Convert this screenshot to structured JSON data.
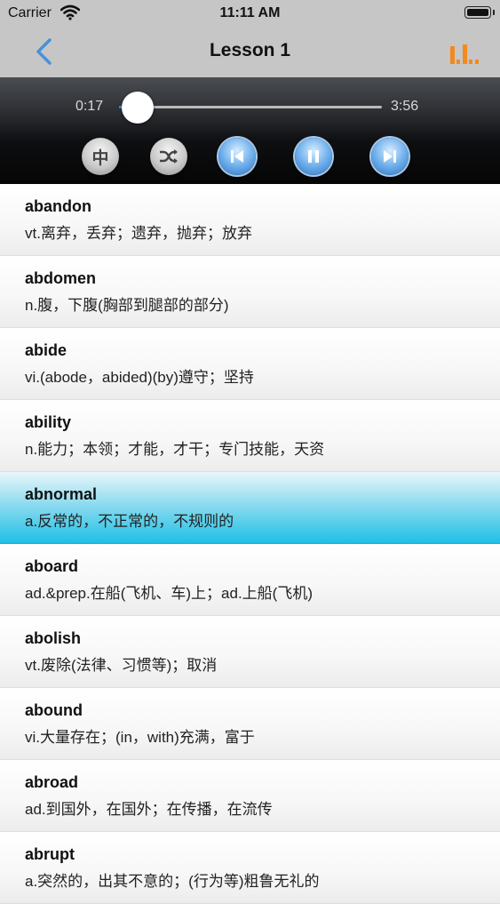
{
  "status_bar": {
    "carrier": "Carrier",
    "time": "11:11 AM"
  },
  "nav": {
    "title": "Lesson 1",
    "back_icon": "chevron-left-icon",
    "stats_icon": "bar-chart-icon",
    "accent": "#4a90d9",
    "stats_color": "#f28a1e"
  },
  "player": {
    "current_time": "0:17",
    "total_time": "3:56",
    "progress": 0.072,
    "mode_label": "中",
    "controls": [
      "chinese-mode",
      "shuffle",
      "previous",
      "pause",
      "next"
    ]
  },
  "words": [
    {
      "word": "abandon",
      "definition": "vt.离弃，丢弃；遗弃，抛弃；放弃",
      "selected": false
    },
    {
      "word": "abdomen",
      "definition": "n.腹，下腹(胸部到腿部的部分)",
      "selected": false
    },
    {
      "word": "abide",
      "definition": "vi.(abode，abided)(by)遵守；坚持",
      "selected": false
    },
    {
      "word": "ability",
      "definition": "n.能力；本领；才能，才干；专门技能，天资",
      "selected": false
    },
    {
      "word": "abnormal",
      "definition": "a.反常的，不正常的，不规则的",
      "selected": true
    },
    {
      "word": "aboard",
      "definition": "ad.&prep.在船(飞机、车)上；ad.上船(飞机)",
      "selected": false
    },
    {
      "word": "abolish",
      "definition": "vt.废除(法律、习惯等)；取消",
      "selected": false
    },
    {
      "word": "abound",
      "definition": "vi.大量存在；(in，with)充满，富于",
      "selected": false
    },
    {
      "word": "abroad",
      "definition": "ad.到国外，在国外；在传播，在流传",
      "selected": false
    },
    {
      "word": "abrupt",
      "definition": "a.突然的，出其不意的；(行为等)粗鲁无礼的",
      "selected": false
    }
  ]
}
